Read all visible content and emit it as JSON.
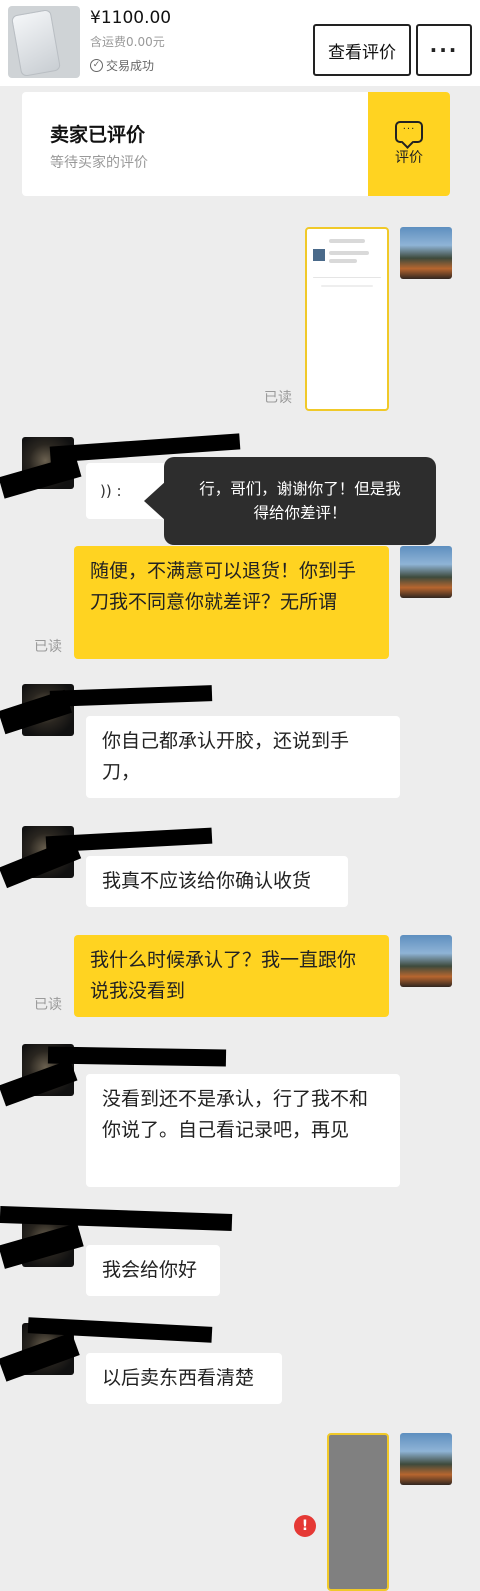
{
  "order": {
    "price": "¥1100.00",
    "shipping": "含运费0.00元",
    "status": "交易成功",
    "review_button": "查看评价",
    "more_button": "···"
  },
  "review_card": {
    "title": "卖家已评价",
    "subtitle": "等待买家的评价",
    "action_label": "评价",
    "action_icon": "chat-bubble-icon"
  },
  "read_label": "已读",
  "messages": [
    {
      "from": "me",
      "type": "image"
    },
    {
      "from": "other",
      "type": "voice",
      "text": ")) :"
    },
    {
      "from": "me",
      "text": "随便，不满意可以退货！你到手刀我不同意你就差评？无所谓",
      "read": true
    },
    {
      "from": "other",
      "text": "你自己都承认开胶，还说到手刀，"
    },
    {
      "from": "other",
      "text": "我真不应该给你确认收货"
    },
    {
      "from": "me",
      "text": "我什么时候承认了？我一直跟你说我没看到",
      "read": true
    },
    {
      "from": "other",
      "text": "没看到还不是承认，行了我不和你说了。自己看记录吧，再见"
    },
    {
      "from": "other",
      "text": "我会给你好"
    },
    {
      "from": "other",
      "text": "以后卖东西看清楚"
    },
    {
      "from": "me",
      "type": "image",
      "failed": true
    }
  ],
  "overlay_text": "行，哥们，谢谢你了！但是我得给你差评！",
  "colors": {
    "accent": "#ffd321",
    "background": "#ededed",
    "error": "#e53935"
  }
}
